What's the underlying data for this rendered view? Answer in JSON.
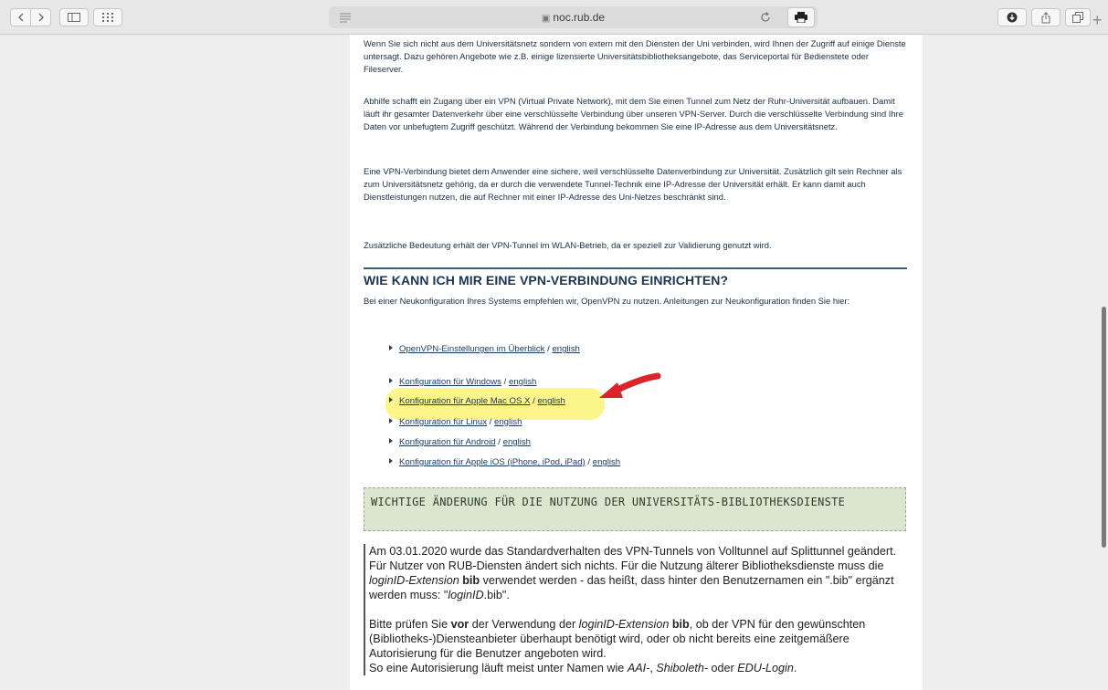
{
  "browser": {
    "url": "noc.rub.de",
    "icons": [
      "chevron-left-icon",
      "chevron-right-icon",
      "sidebar-icon",
      "grid-icon",
      "reader-icon",
      "lock-icon",
      "reload-icon",
      "print-icon",
      "download-icon",
      "share-icon",
      "tabs-icon",
      "new-tab-icon"
    ],
    "plus": "+"
  },
  "page": {
    "paragraphs": [
      "Wenn Sie sich nicht aus dem Universitätsnetz sondern von extern mit den Diensten der Uni verbinden, wird Ihnen der Zugriff auf einige Dienste untersagt. Dazu gehören Angebote wie z.B. einige lizensierte Universitätsbibliotheksangebote, das Serviceportal für Bedienstete oder Fileserver.",
      "Abhilfe schafft ein Zugang über ein VPN (Virtual Private Network), mit dem Sie einen Tunnel zum Netz der Ruhr-Universität aufbauen. Damit läuft ihr gesamter Datenverkehr über eine verschlüsselte Verbindung über unseren VPN-Server. Durch die verschlüsselte Verbindung sind Ihre Daten vor unbefugtem Zugriff geschützt. Während der Verbindung bekommen Sie eine IP-Adresse aus dem Universitätsnetz.",
      "Eine VPN-Verbindung bietet dem Anwender eine sichere, weil verschlüsselte Datenverbindung zur Universität. Zusätzlich gilt sein Rechner als zum Universitätsnetz gehörig, da er durch die verwendete Tunnel-Technik eine IP-Adresse der Universität erhält. Er kann damit auch Dienstleistungen nutzen, die auf Rechner mit einer IP-Adresse des Uni-Netzes beschränkt sind.",
      "Zusätzliche Bedeutung erhält der VPN-Tunnel im WLAN-Betrieb, da er speziell zur Validierung genutzt wird."
    ],
    "heading": "WIE KANN ICH MIR EINE VPN-VERBINDUNG EINRICHTEN?",
    "intro": "Bei einer Neukonfiguration Ihres Systems empfehlen wir, OpenVPN zu nutzen. Anleitungen zur Neukonfiguration finden Sie hier:",
    "separator": " / ",
    "links": [
      {
        "label": "OpenVPN-Einstellungen im Überblick",
        "alt": "english"
      },
      {
        "label": "Konfiguration für Windows",
        "alt": "english"
      },
      {
        "label": "Konfiguration für Apple Mac OS X",
        "alt": "english"
      },
      {
        "label": "Konfiguration für Linux",
        "alt": "english"
      },
      {
        "label": "Konfiguration für Android",
        "alt": "english"
      },
      {
        "label": "Konfiguration für Apple iOS (iPhone, iPod, iPad)",
        "alt": "english"
      }
    ],
    "notice_title": "WICHTIGE ÄNDERUNG FÜR DIE NUTZUNG DER UNIVERSITÄTS-BIBLIOTHEKSDIENSTE",
    "notice_p1": {
      "a": "Am 03.01.2020 wurde das Standardverhalten des VPN-Tunnels von Volltunnel auf Splittunnel geändert. Für Nutzer von RUB-Diensten ändert sich nichts. Für die Nutzung älterer Bibliotheksdienste muss die ",
      "b": "loginID-Extension",
      "c": " ",
      "d": "bib",
      "e": " verwendet werden - das heißt, dass hinter den Benutzernamen ein \".bib\" ergänzt werden muss: \"",
      "f": "loginID",
      "g": ".bib\"."
    },
    "notice_p2": {
      "a": "Bitte prüfen Sie ",
      "b": "vor",
      "c": " der Verwendung der ",
      "d": "loginID-Extension",
      "e": " ",
      "f": "bib",
      "g": ", ob der VPN für den gewünschten (Bibliotheks-)Diensteanbieter überhaupt benötigt wird, oder ob nicht bereits eine zeitgemäßere Autorisierung für die Benutzer angeboten wird."
    },
    "notice_p3": {
      "a": "So eine Autorisierung läuft meist unter Namen wie ",
      "b": "AAI-",
      "c": ", ",
      "d": "Shiboleth-",
      "e": " oder ",
      "f": "EDU-Login",
      "g": "."
    }
  },
  "colors": {
    "highlight": "#fbf58a",
    "arrow": "#d9242a",
    "notice_bg": "#dbe5d0",
    "heading": "#1b3552"
  }
}
